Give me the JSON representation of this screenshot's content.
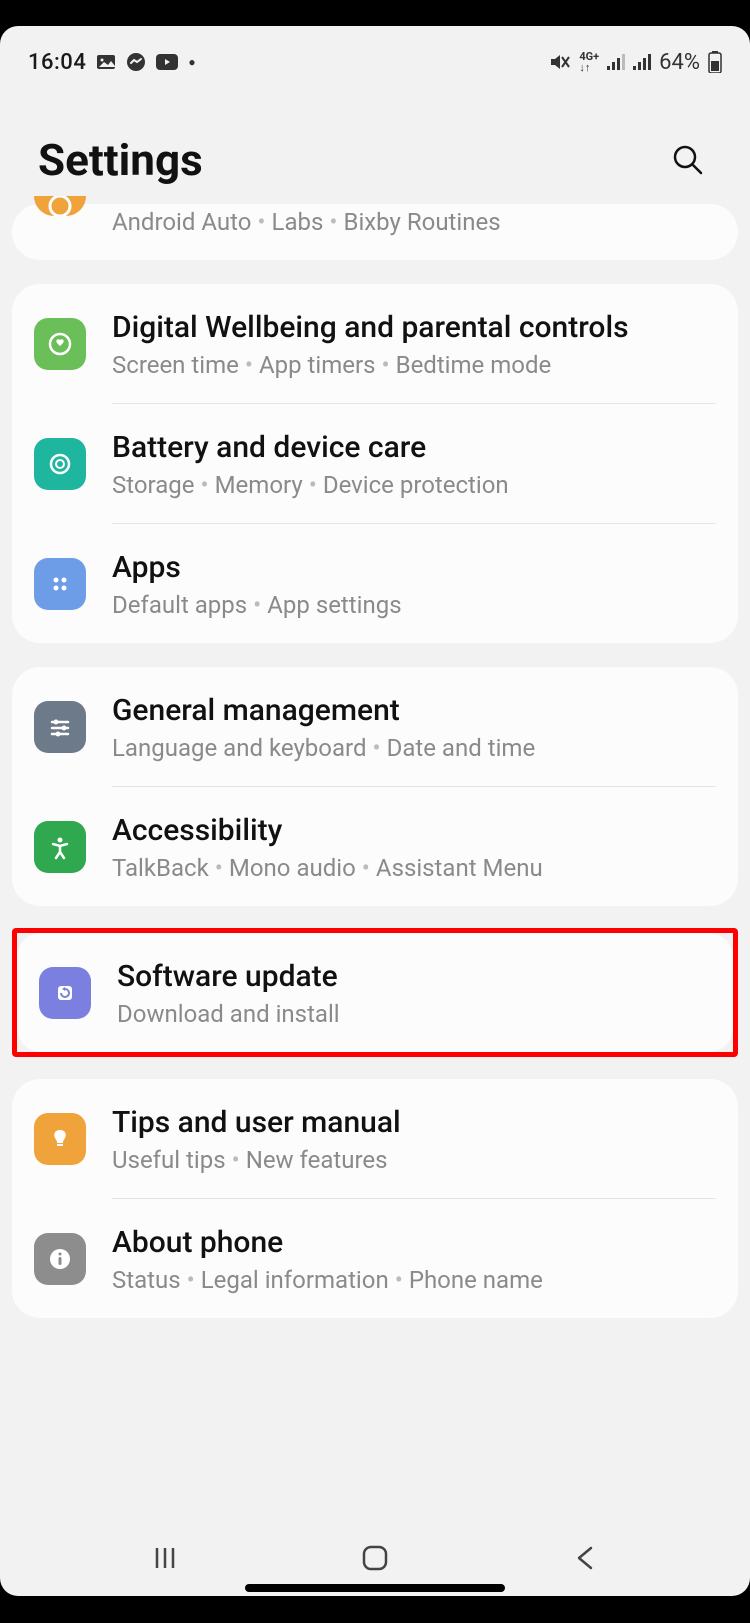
{
  "statusbar": {
    "time": "16:04",
    "battery": "64%"
  },
  "header": {
    "title": "Settings"
  },
  "partial_row": {
    "sub_parts": [
      "Android Auto",
      "Labs",
      "Bixby Routines"
    ]
  },
  "groups": [
    {
      "items": [
        {
          "id": "wellbeing",
          "icon_bg": "#6bbf59",
          "title": "Digital Wellbeing and parental controls",
          "sub_parts": [
            "Screen time",
            "App timers",
            "Bedtime mode"
          ]
        },
        {
          "id": "battery",
          "icon_bg": "#1fb6a0",
          "title": "Battery and device care",
          "sub_parts": [
            "Storage",
            "Memory",
            "Device protection"
          ]
        },
        {
          "id": "apps",
          "icon_bg": "#6e9de8",
          "title": "Apps",
          "sub_parts": [
            "Default apps",
            "App settings"
          ]
        }
      ]
    },
    {
      "items": [
        {
          "id": "general",
          "icon_bg": "#6c7a89",
          "title": "General management",
          "sub_parts": [
            "Language and keyboard",
            "Date and time"
          ]
        },
        {
          "id": "accessibility",
          "icon_bg": "#2fa84f",
          "title": "Accessibility",
          "sub_parts": [
            "TalkBack",
            "Mono audio",
            "Assistant Menu"
          ]
        }
      ]
    },
    {
      "highlight": true,
      "items": [
        {
          "id": "software-update",
          "icon_bg": "#7a7fe0",
          "title": "Software update",
          "sub_parts": [
            "Download and install"
          ]
        }
      ]
    },
    {
      "items": [
        {
          "id": "tips",
          "icon_bg": "#f0a33b",
          "title": "Tips and user manual",
          "sub_parts": [
            "Useful tips",
            "New features"
          ]
        },
        {
          "id": "about",
          "icon_bg": "#8d8d8d",
          "title": "About phone",
          "sub_parts": [
            "Status",
            "Legal information",
            "Phone name"
          ]
        }
      ]
    }
  ]
}
